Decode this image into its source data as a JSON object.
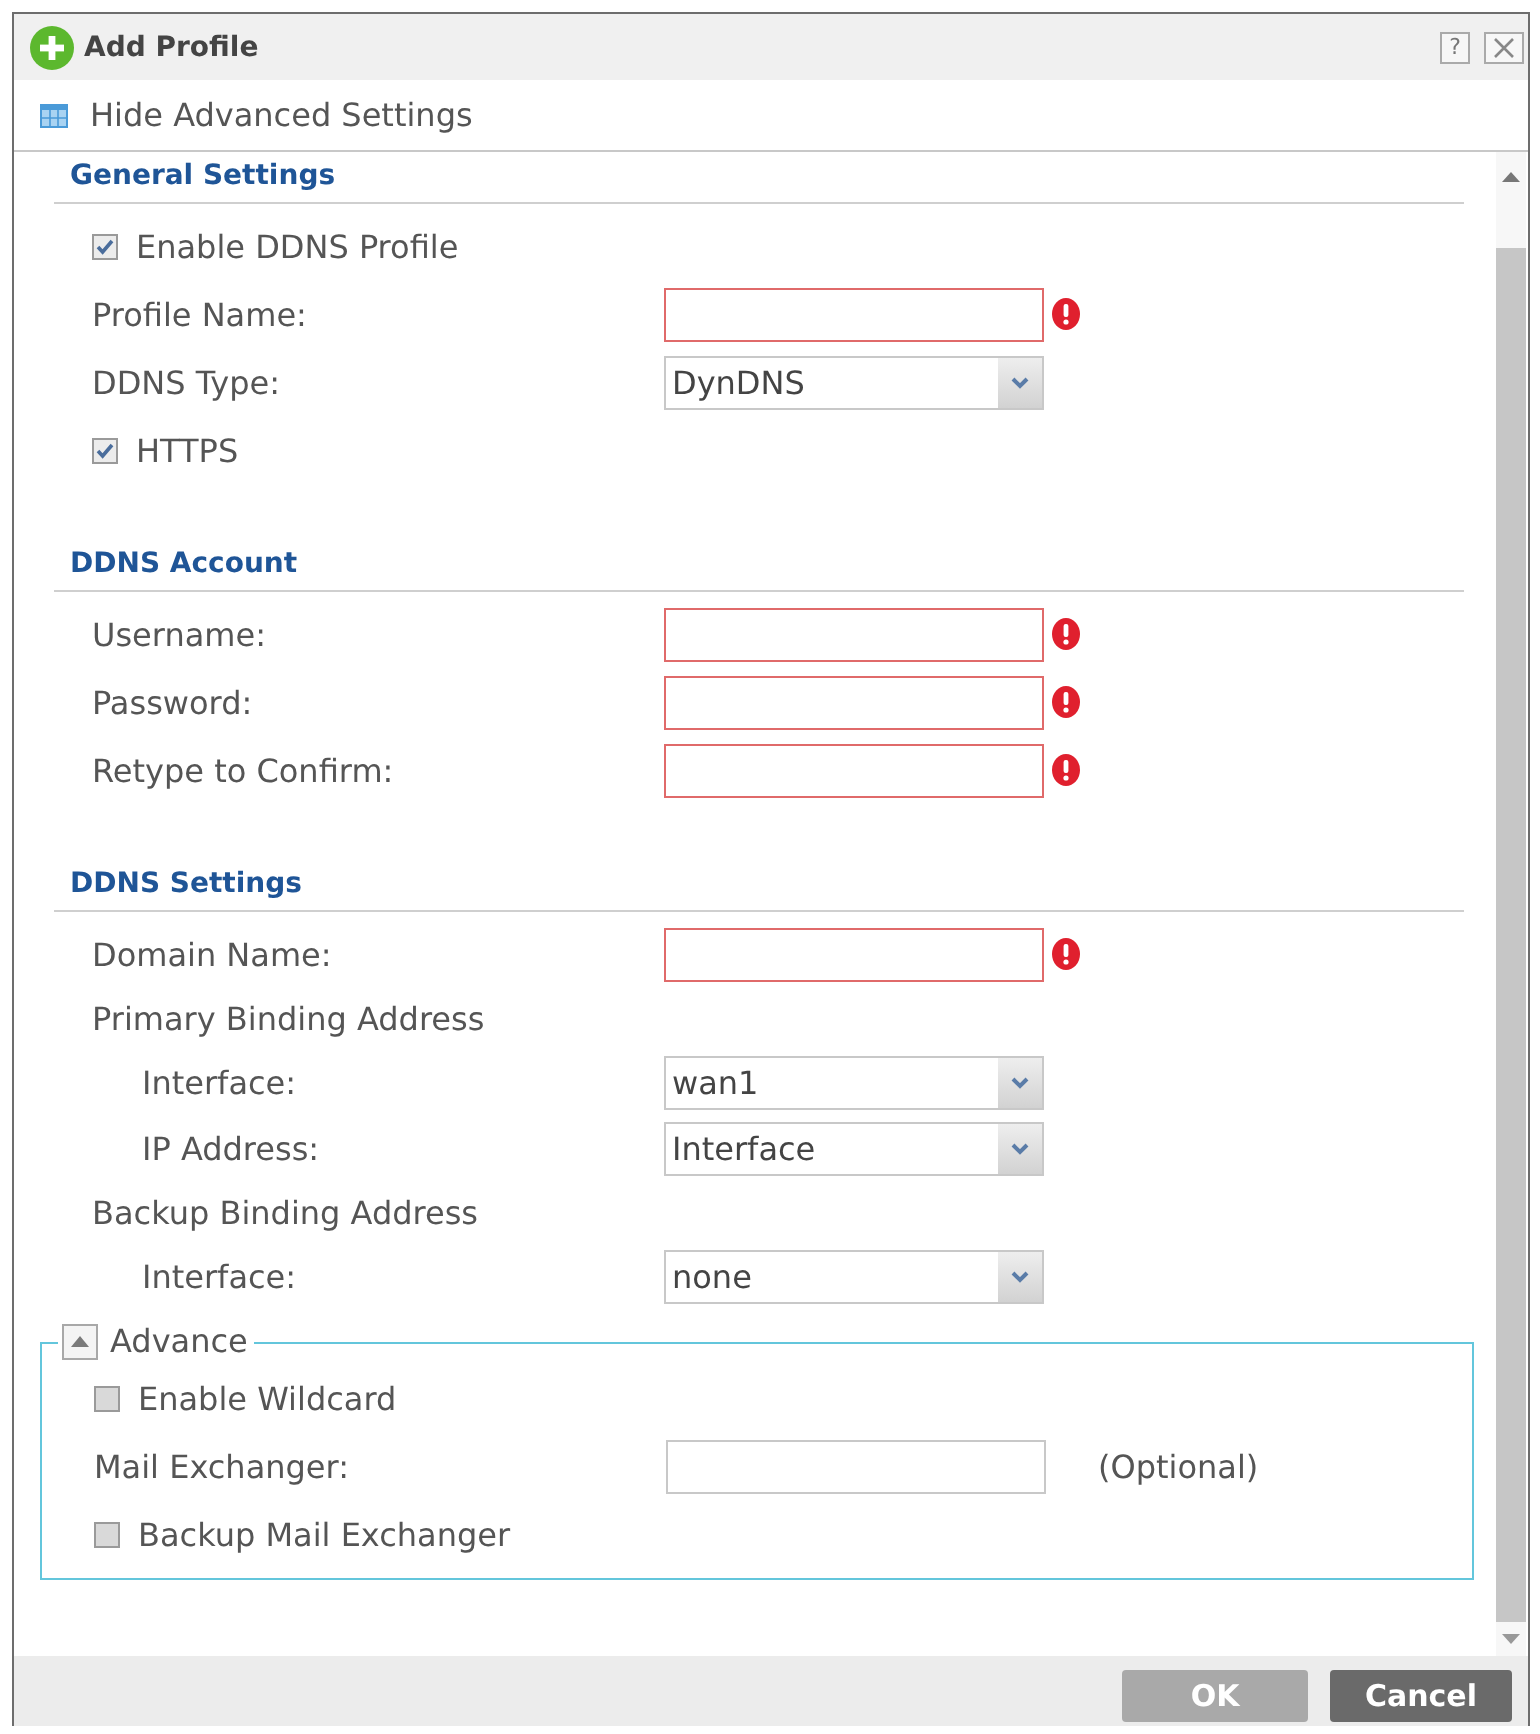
{
  "window": {
    "title": "Add Profile",
    "help_button": "?"
  },
  "toggle": {
    "label": "Hide Advanced Settings"
  },
  "sections": [
    {
      "title": "General Settings",
      "rows": [
        {
          "kind": "checkbox",
          "label": "Enable DDNS Profile",
          "checked": true
        },
        {
          "kind": "input",
          "label": "Profile Name:",
          "error": true
        },
        {
          "kind": "select",
          "label": "DDNS Type:",
          "value": "DynDNS"
        },
        {
          "kind": "checkbox",
          "label": "HTTPS",
          "checked": true
        }
      ]
    },
    {
      "title": "DDNS Account",
      "rows": [
        {
          "kind": "input",
          "label": "Username:",
          "error": true
        },
        {
          "kind": "input",
          "label": "Password:",
          "error": true
        },
        {
          "kind": "input",
          "label": "Retype to Confirm:",
          "error": true
        }
      ]
    },
    {
      "title": "DDNS Settings",
      "rows": [
        {
          "kind": "input",
          "label": "Domain Name:",
          "error": true
        },
        {
          "kind": "group",
          "label": "Primary Binding Address",
          "children": [
            {
              "kind": "select",
              "label": "Interface:",
              "value": "wan1"
            },
            {
              "kind": "select",
              "label": "IP Address:",
              "value": "Interface"
            }
          ]
        },
        {
          "kind": "group",
          "label": "Backup Binding Address",
          "children": [
            {
              "kind": "select",
              "label": "Interface:",
              "value": "none"
            }
          ]
        }
      ]
    }
  ],
  "advance": {
    "label": "Advance",
    "expanded": true,
    "rows": [
      {
        "kind": "checkbox",
        "label": "Enable Wildcard",
        "checked": false
      },
      {
        "kind": "input",
        "label": "Mail Exchanger:",
        "error": false,
        "note": "(Optional)"
      },
      {
        "kind": "checkbox",
        "label": "Backup Mail Exchanger",
        "checked": false
      }
    ]
  },
  "buttons": [
    {
      "label": "OK",
      "disabled": true
    },
    {
      "label": "Cancel",
      "disabled": false
    }
  ]
}
